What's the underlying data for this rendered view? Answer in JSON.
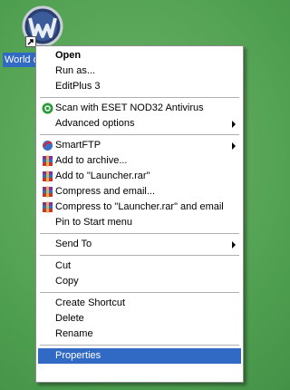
{
  "desktop": {
    "icon_name": "world-of-warcraft-logo-icon",
    "label": "World of Warcraft"
  },
  "menu": {
    "groups": [
      [
        {
          "label": "Open",
          "bold": true
        },
        {
          "label": "Run as..."
        },
        {
          "label": "EditPlus 3"
        }
      ],
      [
        {
          "label": "Scan with ESET NOD32 Antivirus",
          "icon": "eset-nod32-icon"
        },
        {
          "label": "Advanced options",
          "submenu": true
        }
      ],
      [
        {
          "label": "SmartFTP",
          "icon": "smartftp-icon",
          "submenu": true
        },
        {
          "label": "Add to archive...",
          "icon": "winrar-icon"
        },
        {
          "label": "Add to \"Launcher.rar\"",
          "icon": "winrar-icon"
        },
        {
          "label": "Compress and email...",
          "icon": "winrar-icon"
        },
        {
          "label": "Compress to \"Launcher.rar\" and email",
          "icon": "winrar-icon"
        },
        {
          "label": "Pin to Start menu"
        }
      ],
      [
        {
          "label": "Send To",
          "submenu": true
        }
      ],
      [
        {
          "label": "Cut"
        },
        {
          "label": "Copy"
        }
      ],
      [
        {
          "label": "Create Shortcut"
        },
        {
          "label": "Delete"
        },
        {
          "label": "Rename"
        }
      ],
      [
        {
          "label": "Properties",
          "selected": true
        }
      ]
    ]
  },
  "colors": {
    "selection": "#316ac5",
    "desktop_green": "#4e9e4f"
  }
}
